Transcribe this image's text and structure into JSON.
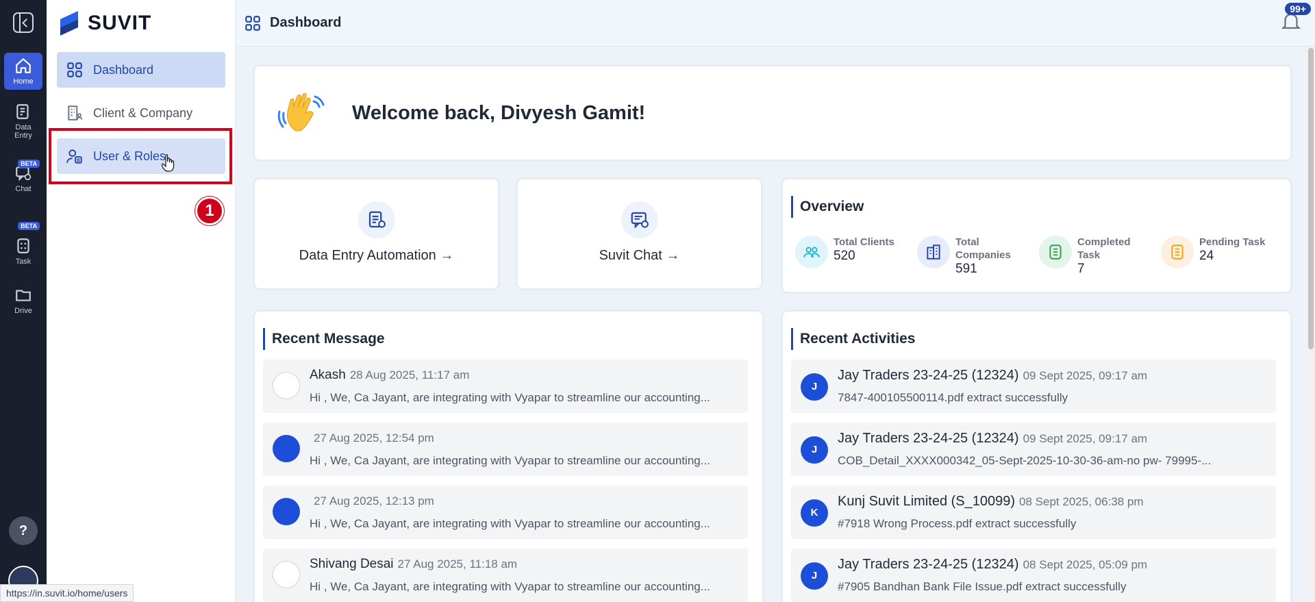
{
  "rail": {
    "items": [
      {
        "label": "Home"
      },
      {
        "label": "Data Entry"
      },
      {
        "label": "Chat",
        "badge": "BETA"
      },
      {
        "label": "Task",
        "badge": "BETA"
      },
      {
        "label": "Drive"
      }
    ],
    "help": "?"
  },
  "nav": {
    "logo": "SUVIT",
    "items": [
      {
        "label": "Dashboard"
      },
      {
        "label": "Client & Company"
      },
      {
        "label": "User & Roles"
      }
    ],
    "step": "1"
  },
  "header": {
    "title": "Dashboard",
    "notification_count": "99+"
  },
  "welcome": {
    "text": "Welcome back, Divyesh Gamit!"
  },
  "quick_links": [
    {
      "label": "Data Entry Automation",
      "arrow": "→"
    },
    {
      "label": "Suvit Chat",
      "arrow": "→"
    }
  ],
  "overview": {
    "title": "Overview",
    "stats": [
      {
        "label": "Total Clients",
        "value": "520",
        "color": "#e0f5fb"
      },
      {
        "label": "Total Companies",
        "value": "591",
        "color": "#e6ecfb"
      },
      {
        "label": "Completed Task",
        "value": "7",
        "color": "#e3f4ea"
      },
      {
        "label": "Pending Task",
        "value": "24",
        "color": "#fdf0e2"
      }
    ]
  },
  "recent_messages": {
    "title": "Recent Message",
    "items": [
      {
        "name": "Akash",
        "time": "28 Aug 2025, 11:17 am",
        "text": "Hi , We, Ca Jayant, are integrating with Vyapar to streamline our accounting..."
      },
      {
        "name": "",
        "time": "27 Aug 2025, 12:54 pm",
        "text": "Hi , We, Ca Jayant, are integrating with Vyapar to streamline our accounting..."
      },
      {
        "name": "",
        "time": "27 Aug 2025, 12:13 pm",
        "text": "Hi , We, Ca Jayant, are integrating with Vyapar to streamline our accounting..."
      },
      {
        "name": "Shivang Desai",
        "time": "27 Aug 2025, 11:18 am",
        "text": "Hi , We, Ca Jayant, are integrating with Vyapar to streamline our accounting..."
      }
    ]
  },
  "recent_activities": {
    "title": "Recent Activities",
    "items": [
      {
        "initial": "J",
        "company": "Jay Traders 23-24-25 (12324)",
        "time": "09 Sept 2025, 09:17 am",
        "text": "7847-400105500114.pdf extract successfully"
      },
      {
        "initial": "J",
        "company": "Jay Traders 23-24-25 (12324)",
        "time": "09 Sept 2025, 09:17 am",
        "text": "COB_Detail_XXXX000342_05-Sept-2025-10-30-36-am-no pw- 79995-..."
      },
      {
        "initial": "K",
        "company": "Kunj Suvit Limited (S_10099)",
        "time": "08 Sept 2025, 06:38 pm",
        "text": "#7918 Wrong Process.pdf extract successfully"
      },
      {
        "initial": "J",
        "company": "Jay Traders 23-24-25 (12324)",
        "time": "08 Sept 2025, 05:09 pm",
        "text": "#7905 Bandhan Bank File Issue.pdf extract successfully"
      }
    ]
  },
  "status_bar": {
    "url": "https://in.suvit.io/home/users"
  }
}
